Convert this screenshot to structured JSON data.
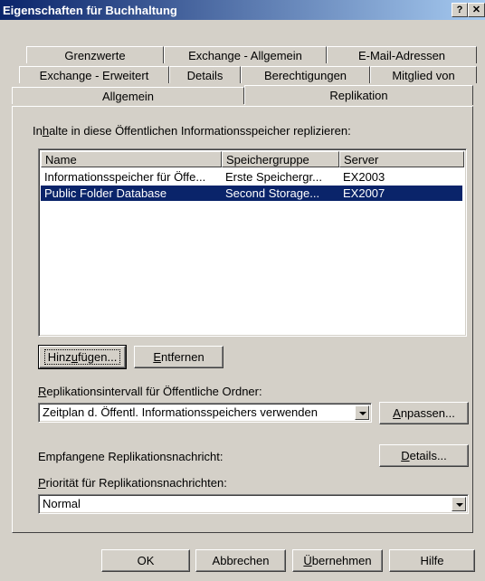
{
  "window": {
    "title": "Eigenschaften für Buchhaltung",
    "help_label": "?",
    "close_label": "✕"
  },
  "tabs": {
    "row1": [
      "Grenzwerte",
      "Exchange - Allgemein",
      "E-Mail-Adressen"
    ],
    "row2": [
      "Exchange - Erweitert",
      "Details",
      "Berechtigungen",
      "Mitglied von"
    ],
    "row3": [
      "Allgemein",
      "Replikation"
    ],
    "active": "Replikation"
  },
  "replication": {
    "content_label_pre": "In",
    "content_label_ul": "h",
    "content_label_post": "alte in diese Öffentlichen Informationsspeicher replizieren:",
    "columns": [
      "Name",
      "Speichergruppe",
      "Server"
    ],
    "rows": [
      {
        "name": "Informationsspeicher für Öffe...",
        "group": "Erste Speichergr...",
        "server": "EX2003",
        "selected": false
      },
      {
        "name": "Public Folder Database",
        "group": "Second Storage...",
        "server": "EX2007",
        "selected": true
      }
    ],
    "add_pre": "Hinz",
    "add_ul": "u",
    "add_post": "fügen...",
    "remove_ul": "E",
    "remove_post": "ntfernen",
    "interval_label_ul": "R",
    "interval_label_post": "eplikationsintervall für Öffentliche Ordner:",
    "interval_value": "Zeitplan d. Öffentl. Informationsspeichers verwenden",
    "customize_ul": "A",
    "customize_post": "npassen...",
    "received_label": "Empfangene Replikationsnachricht:",
    "details_ul": "D",
    "details_post": "etails...",
    "priority_label_ul": "P",
    "priority_label_post": "riorität für Replikationsnachrichten:",
    "priority_value": "Normal"
  },
  "footer": {
    "ok": "OK",
    "cancel": "Abbrechen",
    "apply_ul": "Ü",
    "apply_post": "bernehmen",
    "help": "Hilfe"
  }
}
